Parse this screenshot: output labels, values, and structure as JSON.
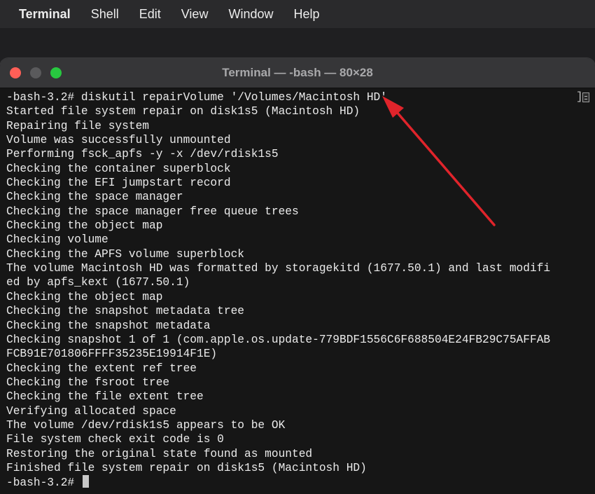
{
  "menubar": {
    "app_name": "Terminal",
    "items": [
      "Shell",
      "Edit",
      "View",
      "Window",
      "Help"
    ]
  },
  "window": {
    "title": "Terminal — -bash — 80×28"
  },
  "terminal": {
    "lines": [
      "-bash-3.2# diskutil repairVolume '/Volumes/Macintosh HD'",
      "Started file system repair on disk1s5 (Macintosh HD)",
      "Repairing file system",
      "Volume was successfully unmounted",
      "Performing fsck_apfs -y -x /dev/rdisk1s5",
      "Checking the container superblock",
      "Checking the EFI jumpstart record",
      "Checking the space manager",
      "Checking the space manager free queue trees",
      "Checking the object map",
      "Checking volume",
      "Checking the APFS volume superblock",
      "The volume Macintosh HD was formatted by storagekitd (1677.50.1) and last modifi",
      "ed by apfs_kext (1677.50.1)",
      "Checking the object map",
      "Checking the snapshot metadata tree",
      "Checking the snapshot metadata",
      "Checking snapshot 1 of 1 (com.apple.os.update-779BDF1556C6F688504E24FB29C75AFFAB",
      "FCB91E701806FFFF35235E19914F1E)",
      "Checking the extent ref tree",
      "Checking the fsroot tree",
      "Checking the file extent tree",
      "Verifying allocated space",
      "The volume /dev/rdisk1s5 appears to be OK",
      "File system check exit code is 0",
      "Restoring the original state found as mounted",
      "Finished file system repair on disk1s5 (Macintosh HD)"
    ],
    "prompt": "-bash-3.2# "
  },
  "annotation": {
    "arrow_color": "#e0242b"
  }
}
